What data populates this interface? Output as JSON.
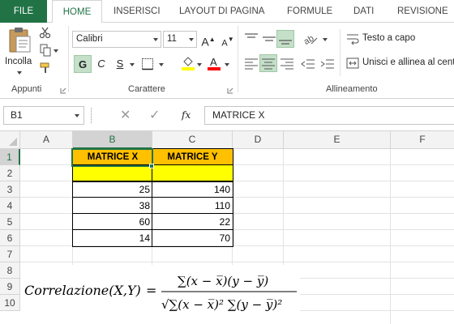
{
  "ribbon": {
    "tabs": [
      {
        "label": "FILE"
      },
      {
        "label": "HOME"
      },
      {
        "label": "INSERISCI"
      },
      {
        "label": "LAYOUT DI PAGINA"
      },
      {
        "label": "FORMULE"
      },
      {
        "label": "DATI"
      },
      {
        "label": "REVISIONE"
      }
    ],
    "clipboard": {
      "paste_label": "Incolla",
      "group_label": "Appunti"
    },
    "font": {
      "font_name": "Calibri",
      "font_size": "11",
      "bold_label": "G",
      "italic_label": "C",
      "underline_label": "S",
      "grow_label": "A",
      "shrink_label": "A",
      "group_label": "Carattere"
    },
    "alignment": {
      "wrap_label": "Testo a capo",
      "merge_label": "Unisci e allinea al centro",
      "group_label": "Allineamento"
    }
  },
  "formula_bar": {
    "name_box": "B1",
    "fx_label": "fx",
    "content": "MATRICE X"
  },
  "sheet": {
    "columns": [
      "A",
      "B",
      "C",
      "D",
      "E",
      "F"
    ],
    "rows": [
      "1",
      "2",
      "3",
      "4",
      "5",
      "6",
      "7",
      "8",
      "9",
      "10"
    ],
    "active_cell": "B1",
    "header_x": "MATRICE X",
    "header_y": "MATRICE Y",
    "data": [
      {
        "x": "25",
        "y": "140"
      },
      {
        "x": "38",
        "y": "110"
      },
      {
        "x": "60",
        "y": "22"
      },
      {
        "x": "14",
        "y": "70"
      }
    ]
  },
  "formula_text": {
    "lhs": "Correlazione(X,Y)",
    "equals": "=",
    "numerator": "∑(x − x̅)(y − y̅)",
    "denominator": "√∑(x − x̅)² ∑(y − y̅)²"
  },
  "colors": {
    "accent": "#217346",
    "header_fill": "#ffc000",
    "highlight_fill": "#ffff00"
  }
}
